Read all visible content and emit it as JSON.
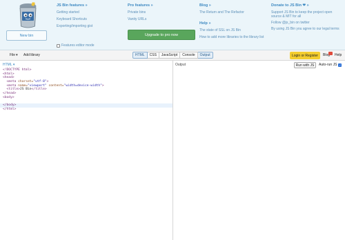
{
  "menu": {
    "new_bin": "New bin",
    "features": {
      "title": "JS Bin features »",
      "links": [
        "Getting started",
        "Keyboard Shortcuts",
        "Exporting/importing gist"
      ],
      "toggle_label": "Features editor mode"
    },
    "pro": {
      "title": "Pro features »",
      "links": [
        "Private bins",
        "Vanity URLs"
      ],
      "upgrade": "Upgrade to pro now"
    },
    "blog": {
      "title": "Blog »",
      "links": [
        "The Return and The Refactor"
      ]
    },
    "help": {
      "title": "Help »",
      "links": [
        "The state of SSL on JS Bin",
        "How to add more libraries to the library list"
      ]
    },
    "donate": {
      "title": "Donate to JS Bin ❤ »",
      "paras": [
        "Support JS Bin to keep the project open source & MIT for all",
        "Follow @js_bin on twitter",
        "By using JS Bin you agree to our legal terms"
      ]
    }
  },
  "toolbar": {
    "file": "File",
    "file_caret": "▾",
    "add_library": "Add library",
    "tabs": [
      "HTML",
      "CSS",
      "JavaScript",
      "Console",
      "Output"
    ],
    "active_tabs": [
      "HTML",
      "Output"
    ],
    "login": "Login or Register",
    "blog": "Blog",
    "help": "Help"
  },
  "editor": {
    "panel_label": "HTML ▾",
    "code": {
      "l1": "<!DOCTYPE html>",
      "l2": "<html>",
      "l3": "<head>",
      "l4_tag_open": "<meta ",
      "l4_attr": "charset=",
      "l4_val": "\"utf-8\"",
      "l4_close": ">",
      "l5_tag_open": "<meta ",
      "l5_attr1": "name=",
      "l5_val1": "\"viewport\"",
      "l5_attr2": " content=",
      "l5_val2": "\"width=device-width\"",
      "l5_close": ">",
      "l6_open": "<title>",
      "l6_text": "JS Bin",
      "l6_close": "</title>",
      "l7": "</head>",
      "l8": "<body>",
      "l9": "",
      "l10": "</body>",
      "l11": "</html>"
    }
  },
  "output": {
    "label": "Output",
    "run": "Run with JS",
    "autorun": "Auto-run JS",
    "autorun_checked": true
  },
  "colors": {
    "accent": "#3e89c2",
    "upgrade": "#59a65c",
    "login": "#f4cd2e",
    "menu_bg": "#ebf5fa"
  }
}
